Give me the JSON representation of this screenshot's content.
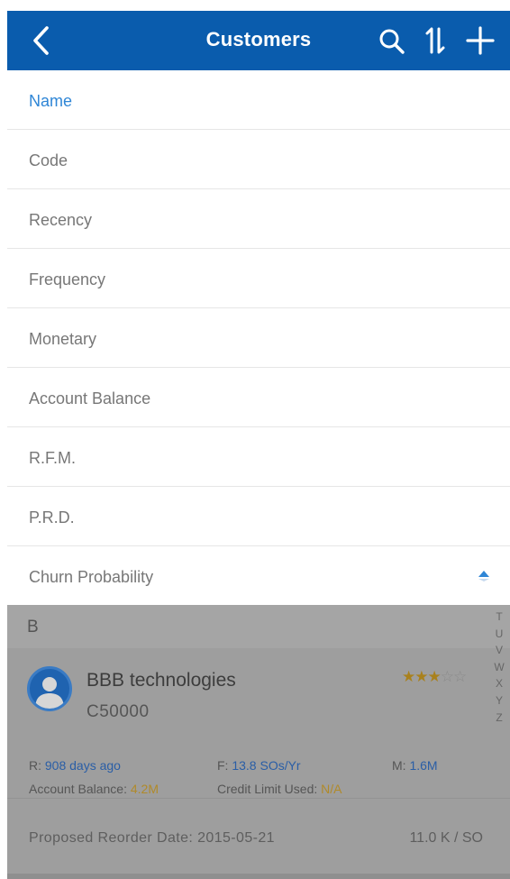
{
  "header": {
    "title": "Customers",
    "bar_color": "#0a5cad",
    "icons": [
      "chevron-left-icon",
      "search-icon",
      "sort-icon",
      "plus-icon"
    ]
  },
  "sort_menu": {
    "active_color": "#2f86d6",
    "items": [
      {
        "label": "Name",
        "active": true
      },
      {
        "label": "Code"
      },
      {
        "label": "Recency"
      },
      {
        "label": "Frequency"
      },
      {
        "label": "Monetary"
      },
      {
        "label": "Account Balance"
      },
      {
        "label": "R.F.M."
      },
      {
        "label": "P.R.D."
      },
      {
        "label": "Churn Probability",
        "sort_direction": "ascending"
      }
    ]
  },
  "list": {
    "section_letter": "B",
    "index_letters": [
      "T",
      "U",
      "V",
      "W",
      "X",
      "Y",
      "Z"
    ],
    "customer": {
      "name": "BBB technologies",
      "code": "C50000",
      "rating": 3,
      "rating_max": 5,
      "recency_label": "R:",
      "recency_value": "908 days ago",
      "frequency_label": "F:",
      "frequency_value": "13.8 SOs/Yr",
      "monetary_label": "M:",
      "monetary_value": "1.6M",
      "balance_label": "Account Balance:",
      "balance_value": "4.2M",
      "credit_label": "Credit Limit Used:",
      "credit_value": "N/A",
      "reorder_label": "Proposed Reorder Date:",
      "reorder_date": "2015-05-21",
      "reorder_rate": "11.0 K / SO"
    }
  }
}
